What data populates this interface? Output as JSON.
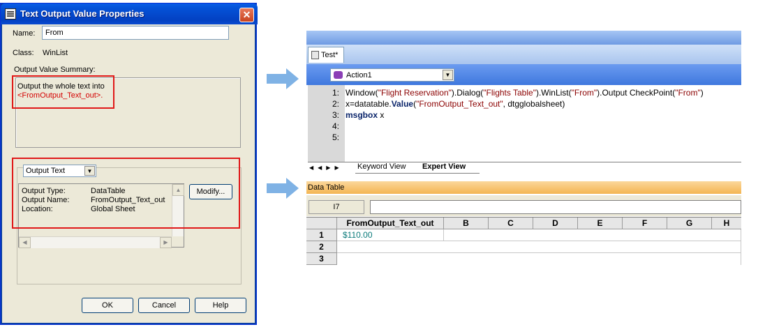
{
  "dialog": {
    "title": "Text Output Value Properties",
    "close_glyph": "✕",
    "name_label": "Name:",
    "name_value": "From",
    "class_label": "Class:",
    "class_value": "WinList",
    "summary_label": "Output Value Summary:",
    "summary_line1": "Output the whole text into",
    "summary_line2": "<FromOutput_Text_out>.",
    "output_type_select": "Output Text",
    "details": [
      {
        "key": "Output Type:",
        "value": "DataTable"
      },
      {
        "key": "Output Name:",
        "value": "FromOutput_Text_out"
      },
      {
        "key": "Location:",
        "value": "Global Sheet"
      }
    ],
    "modify_button": "Modify...",
    "ok_button": "OK",
    "cancel_button": "Cancel",
    "help_button": "Help"
  },
  "ide": {
    "doc_tab": "Test*",
    "action_select": "Action1",
    "line_numbers": [
      "1:",
      "2:",
      "3:",
      "4:",
      "5:"
    ],
    "code": {
      "l1_a": "Window(",
      "l1_s1": "\"Flight Reservation\"",
      "l1_b": ").Dialog(",
      "l1_s2": "\"Flights Table\"",
      "l1_c": ").WinList(",
      "l1_s3": "\"From\"",
      "l1_d": ").Output CheckPoint(",
      "l1_s4": "\"From\"",
      "l1_e": ")",
      "l2_a": "x=datatable.",
      "l2_kw": "Value",
      "l2_b": "(",
      "l2_s": "\"FromOutput_Text_out\"",
      "l2_c": ", dtgglobalsheet)",
      "l3_kw": "msgbox",
      "l3_b": " x"
    },
    "nav_arrows": "◀◀▶▶",
    "tab_keyword": "Keyword View",
    "tab_expert": "Expert View"
  },
  "datatable": {
    "title": "Data Table",
    "cell_ref": "I7",
    "columns": [
      "FromOutput_Text_out",
      "B",
      "C",
      "D",
      "E",
      "F",
      "G",
      "H"
    ],
    "rows": [
      "1",
      "2",
      "3"
    ],
    "cell_a1": "$110.00"
  },
  "colors": {
    "highlight": "#e01818",
    "titlebar": "#0553d8",
    "arrow": "#7fb2e5"
  }
}
